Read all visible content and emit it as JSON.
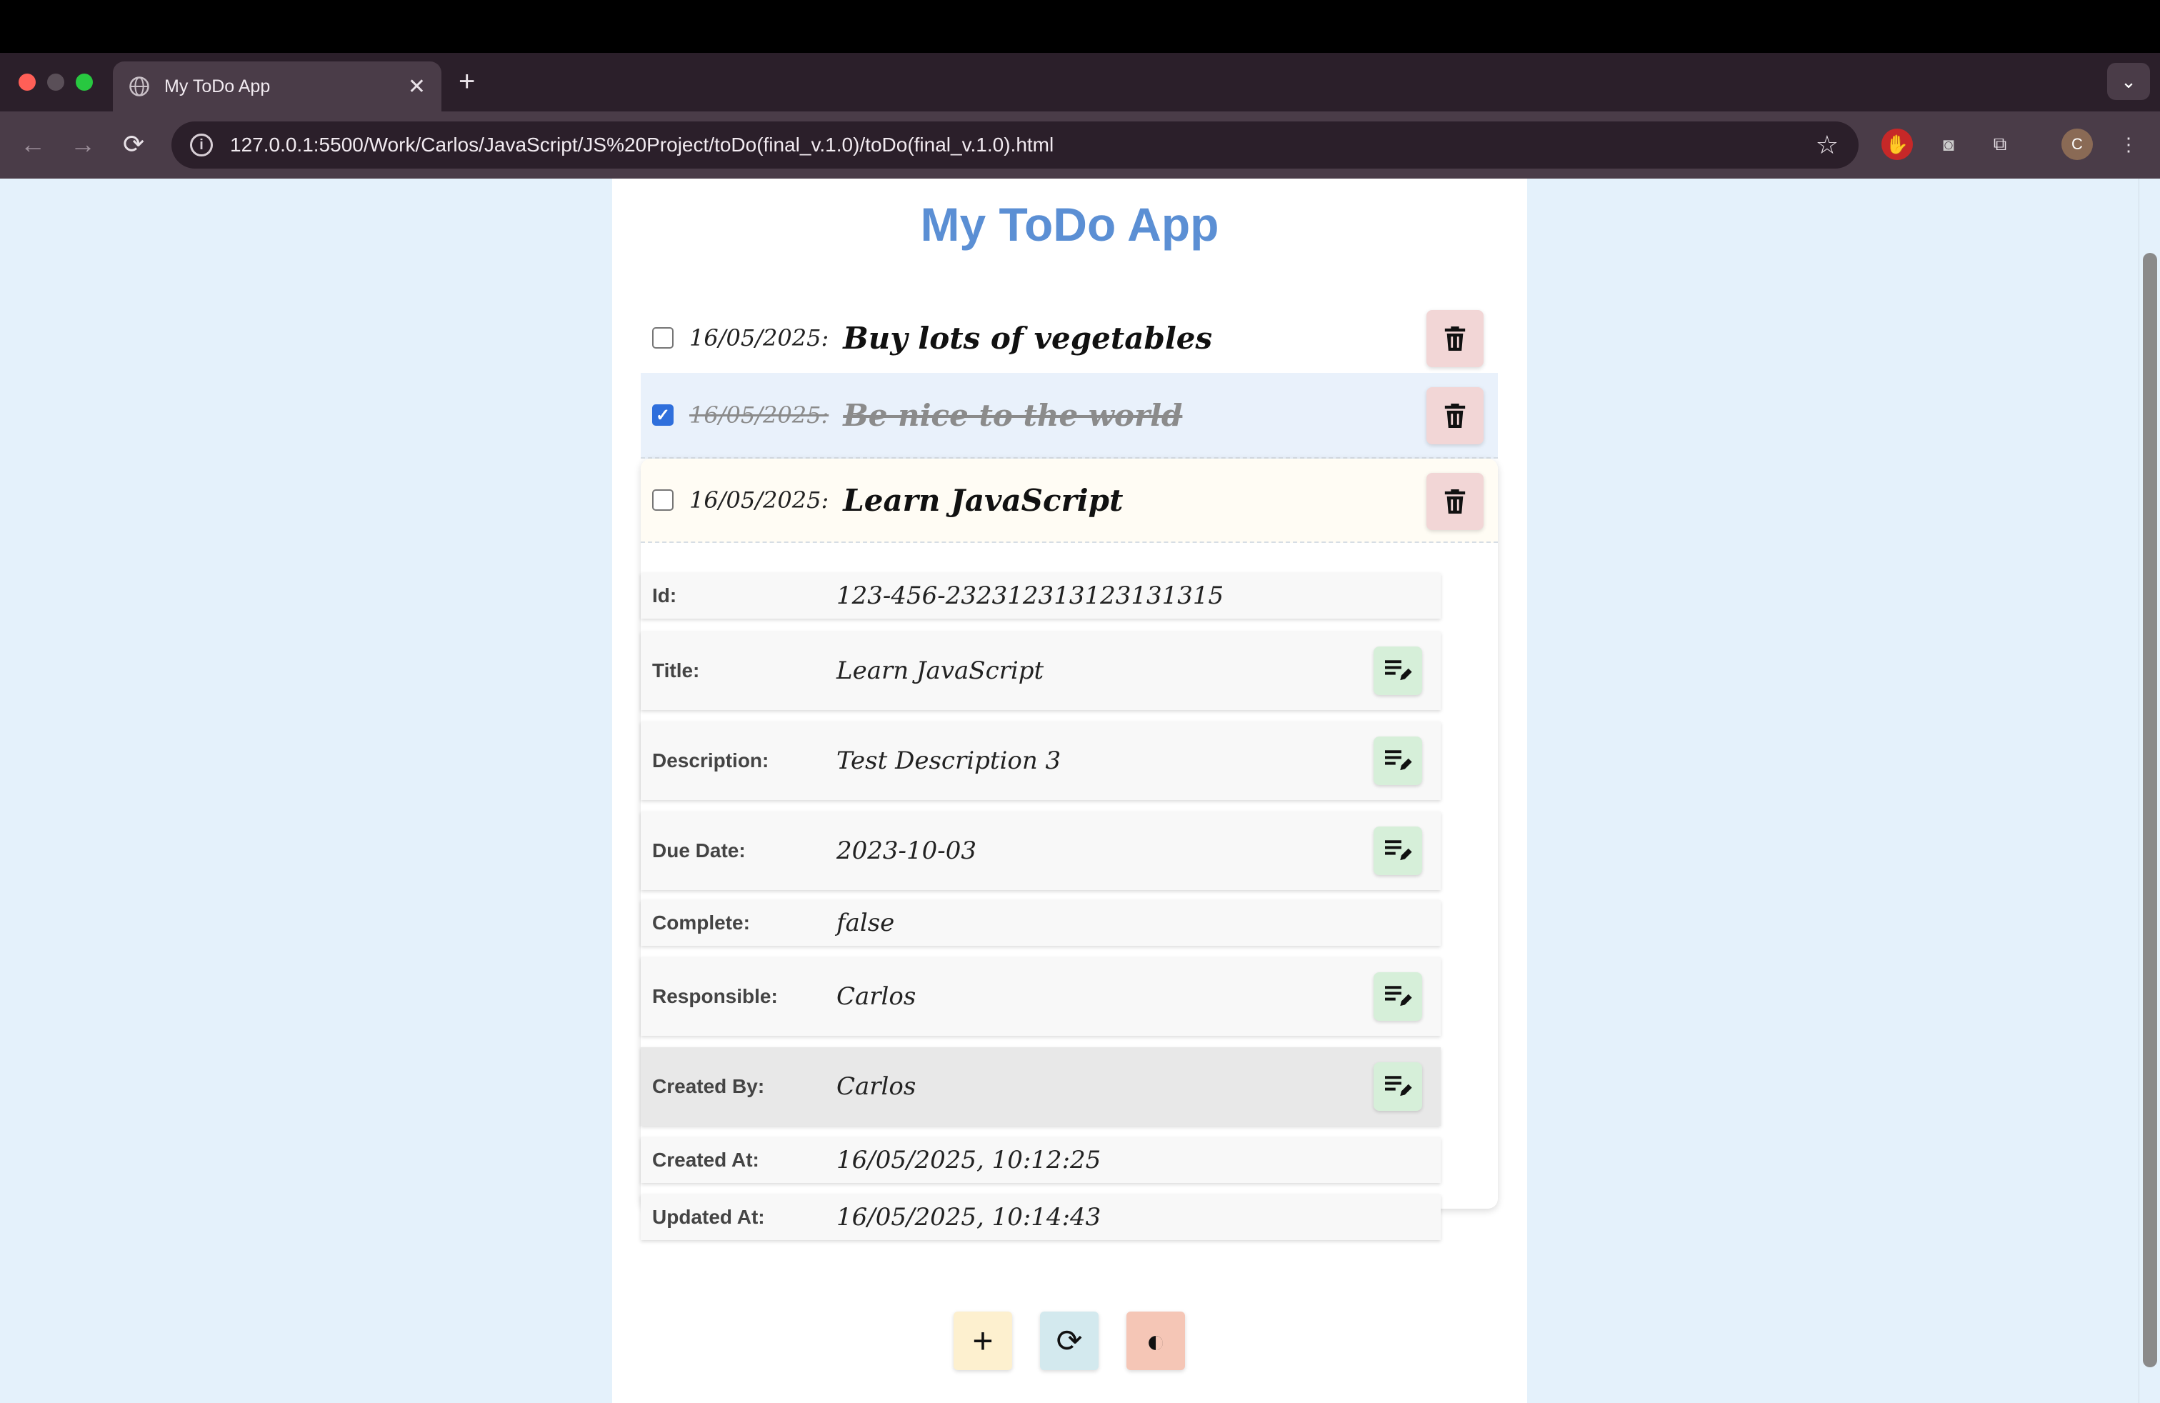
{
  "browser": {
    "tab_title": "My ToDo App",
    "tab_close": "✕",
    "new_tab": "+",
    "tab_dropdown": "⌄",
    "url": "127.0.0.1:5500/Work/Carlos/JavaScript/JS%20Project/toDo(final_v.1.0)/toDo(final_v.1.0).html",
    "profile_initial": "C"
  },
  "app": {
    "title": "My ToDo App",
    "todos": [
      {
        "date": "16/05/2025:",
        "title": "Buy lots of vegetables",
        "checked": false
      },
      {
        "date": "16/05/2025:",
        "title": "Be nice to the world",
        "checked": true
      },
      {
        "date": "16/05/2025:",
        "title": "Learn JavaScript",
        "checked": false,
        "expanded": true
      }
    ],
    "details": [
      {
        "label": "Id:",
        "value": "123-456-232312313123131315",
        "editable": false
      },
      {
        "label": "Title:",
        "value": "Learn JavaScript",
        "editable": true
      },
      {
        "label": "Description:",
        "value": "Test Description 3",
        "editable": true
      },
      {
        "label": "Due Date:",
        "value": "2023-10-03",
        "editable": true
      },
      {
        "label": "Complete:",
        "value": "false",
        "editable": false
      },
      {
        "label": "Responsible:",
        "value": "Carlos",
        "editable": true
      },
      {
        "label": "Created By:",
        "value": "Carlos",
        "editable": true
      },
      {
        "label": "Created At:",
        "value": "16/05/2025, 10:12:25",
        "editable": false
      },
      {
        "label": "Updated At:",
        "value": "16/05/2025, 10:14:43",
        "editable": false
      }
    ],
    "actions": {
      "add_icon": "+",
      "refresh_icon": "⟳",
      "theme_icon": "◐"
    },
    "colors": {
      "title": "#5b8fd4",
      "page_bg": "#e4f1fb",
      "delete_bg": "#f2d6d6",
      "edit_bg": "#d6efd9",
      "add_bg": "#fdf0cf",
      "refresh_bg": "#d3e9ee",
      "theme_bg": "#f5c6b6"
    }
  }
}
